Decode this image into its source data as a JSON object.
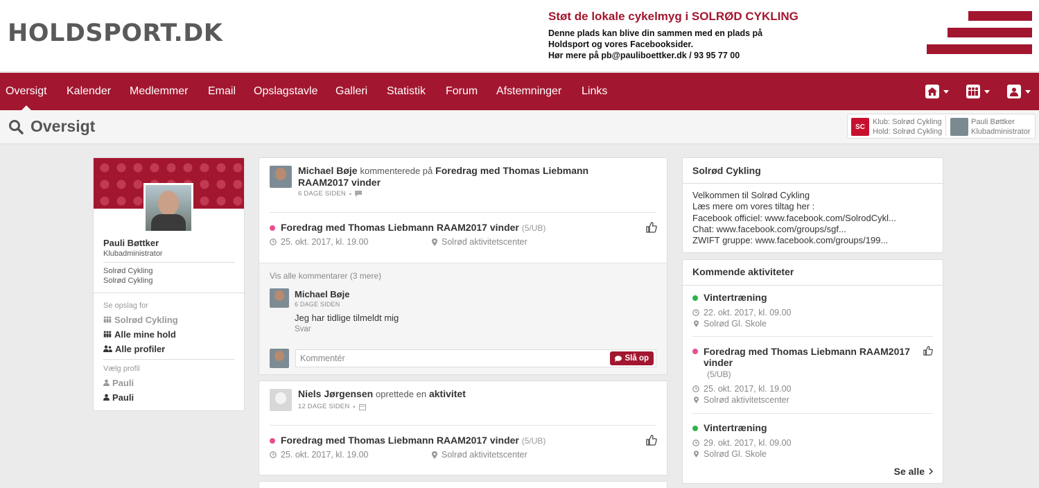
{
  "header": {
    "logo": "HOLDSPORT.DK",
    "ad": {
      "title": "Støt de lokale cykelmyg i SOLRØD CYKLING",
      "lines": [
        "Denne plads kan blive din sammen med en plads på",
        "Holdsport og vores Facebooksider.",
        "Hør mere på pb@pauliboettker.dk / 93 95 77 00"
      ]
    },
    "brand_color": "#a3162f"
  },
  "nav": {
    "items": [
      "Oversigt",
      "Kalender",
      "Medlemmer",
      "Email",
      "Opslagstavle",
      "Galleri",
      "Statistik",
      "Forum",
      "Afstemninger",
      "Links"
    ],
    "icons": [
      "home-icon",
      "team-icon",
      "user-icon"
    ]
  },
  "subheader": {
    "title": "Oversigt",
    "club_line": "Klub: Solrød Cykling",
    "team_line": "Hold: Solrød Cykling",
    "user_name": "Pauli Bøttker",
    "user_role": "Klubadministrator"
  },
  "profile": {
    "name": "Pauli Bøttker",
    "role": "Klubadministrator",
    "clubs": [
      "Solrød Cykling",
      "Solrød Cykling"
    ],
    "see_posts_label": "Se opslag for",
    "filters": [
      "Solrød Cykling",
      "Alle mine hold",
      "Alle profiler"
    ],
    "choose_profile_label": "Vælg profil",
    "profiles": [
      "Pauli",
      "Pauli"
    ]
  },
  "feed": [
    {
      "author": "Michael Bøje",
      "action": "kommenterede på",
      "target": "Foredrag med Thomas Liebmann RAAM2017 vinder",
      "time": "6 DAGE SIDEN",
      "activity": {
        "title": "Foredrag med Thomas Liebmann RAAM2017 vinder",
        "count": "(5/UB)",
        "date": "25. okt. 2017, kl. 19.00",
        "place": "Solrød aktivitetscenter"
      },
      "show_all": "Vis alle kommentarer (3 mere)",
      "comment": {
        "author": "Michael Bøje",
        "time": "6 DAGE SIDEN",
        "text": "Jeg har tidlige tilmeldt mig",
        "reply": "Svar"
      },
      "comment_placeholder": "Kommentér",
      "post_button": "Slå op"
    },
    {
      "author": "Niels Jørgensen",
      "action": "oprettede en",
      "target": "aktivitet",
      "time": "12 DAGE SIDEN",
      "activity": {
        "title": "Foredrag med Thomas Liebmann RAAM2017 vinder",
        "count": "(5/UB)",
        "date": "25. okt. 2017, kl. 19.00",
        "place": "Solrød aktivitetscenter"
      }
    }
  ],
  "club_box": {
    "title": "Solrød Cykling",
    "lines": [
      "Velkommen til Solrød Cykling",
      "Læs mere om vores tiltag her :",
      "Facebook officiel: www.facebook.com/SolrodCykl...",
      "Chat: www.facebook.com/groups/sgf...",
      "ZWIFT gruppe: www.facebook.com/groups/199..."
    ]
  },
  "upcoming": {
    "title": "Kommende aktiviteter",
    "items": [
      {
        "title": "Vintertræning",
        "date": "22. okt. 2017, kl. 09.00",
        "place": "Solrød Gl. Skole",
        "color": "green"
      },
      {
        "title": "Foredrag med Thomas Liebmann RAAM2017 vinder",
        "count": "(5/UB)",
        "date": "25. okt. 2017, kl. 19.00",
        "place": "Solrød aktivitetscenter",
        "color": "pink"
      },
      {
        "title": "Vintertræning",
        "date": "29. okt. 2017, kl. 09.00",
        "place": "Solrød Gl. Skole",
        "color": "green"
      }
    ],
    "see_all": "Se alle"
  }
}
